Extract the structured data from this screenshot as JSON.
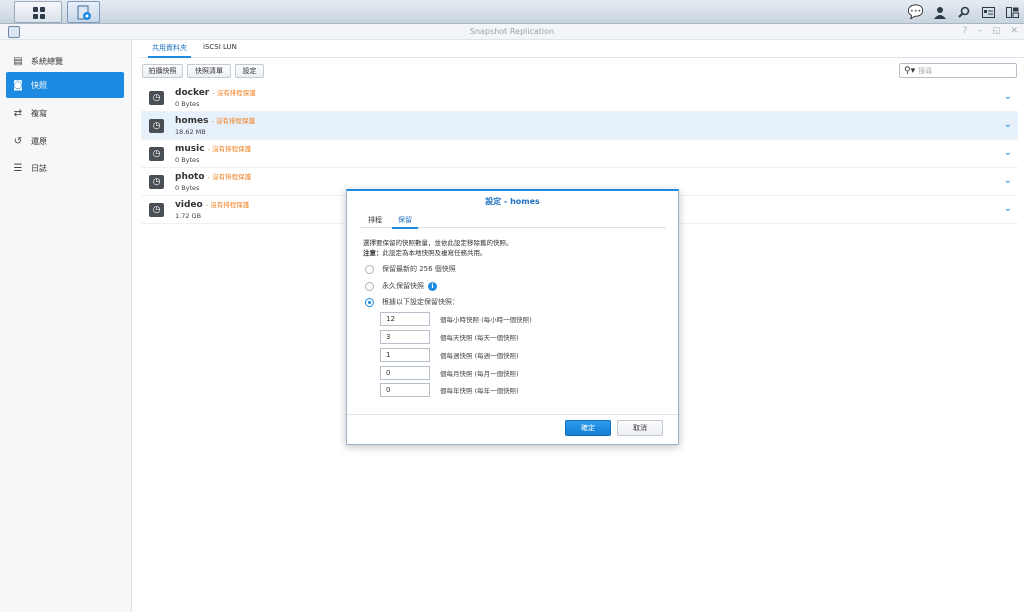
{
  "window": {
    "title": "Snapshot Replication"
  },
  "taskbar": {
    "icons": [
      "main-menu-icon",
      "snapshot-replication-app-icon",
      "chat-icon",
      "user-icon",
      "search-icon",
      "widgets-icon",
      "windows-icon"
    ]
  },
  "sidebar": {
    "items": [
      {
        "label": "系統總覽",
        "icon": "overview-icon"
      },
      {
        "label": "快照",
        "icon": "camera-icon",
        "active": true
      },
      {
        "label": "複寫",
        "icon": "replication-icon"
      },
      {
        "label": "還原",
        "icon": "recovery-icon"
      },
      {
        "label": "日誌",
        "icon": "log-icon"
      }
    ]
  },
  "main": {
    "tabs": [
      {
        "label": "共用資料夾",
        "active": true
      },
      {
        "label": "iSCSI LUN"
      }
    ],
    "toolbar": {
      "take_snapshot": "拍攝快照",
      "snapshot_list": "快照清單",
      "settings": "設定"
    },
    "search": {
      "placeholder": "搜尋"
    },
    "shares": [
      {
        "name": "docker",
        "status": "- 沒有排程保護",
        "size": "0 Bytes"
      },
      {
        "name": "homes",
        "status": "- 沒有排程保護",
        "size": "18.62 MB",
        "selected": true
      },
      {
        "name": "music",
        "status": "- 沒有排程保護",
        "size": "0 Bytes"
      },
      {
        "name": "photo",
        "status": "- 沒有排程保護",
        "size": "0 Bytes"
      },
      {
        "name": "video",
        "status": "- 沒有排程保護",
        "size": "1.72 GB"
      }
    ]
  },
  "dialog": {
    "title": "設定 - homes",
    "tabs": [
      {
        "label": "排程"
      },
      {
        "label": "保留",
        "active": true
      }
    ],
    "desc_line1": "選擇要保留的快照數量，並依此設定移除舊的快照。",
    "note_label": "注意：",
    "desc_line2": "此設定為本地快照及複寫任務共用。",
    "options": [
      {
        "label": "保留最新的 256 個快照",
        "selected": false
      },
      {
        "label": "永久保留快照",
        "selected": false,
        "info": true
      },
      {
        "label": "根據以下設定保留快照：",
        "selected": true
      }
    ],
    "retention": [
      {
        "value": "12",
        "label": "個每小時快照 (每小時一個快照)"
      },
      {
        "value": "3",
        "label": "個每天快照 (每天一個快照)"
      },
      {
        "value": "1",
        "label": "個每週快照 (每週一個快照)"
      },
      {
        "value": "0",
        "label": "個每月快照 (每月一個快照)"
      },
      {
        "value": "0",
        "label": "個每年快照 (每年一個快照)"
      }
    ],
    "ok": "確定",
    "cancel": "取消"
  },
  "colors": {
    "accent": "#1c8ae0",
    "warning": "#f07c1a",
    "selected_row": "#e6f1fb"
  }
}
